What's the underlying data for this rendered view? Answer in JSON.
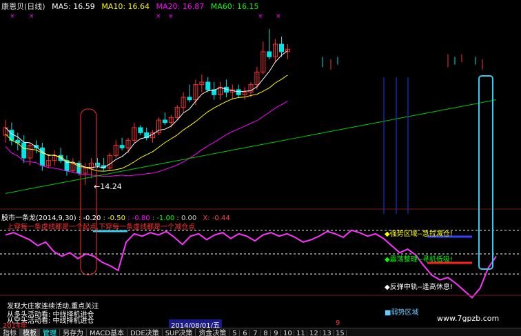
{
  "header": {
    "stock_name": "康恩贝(日线)",
    "ma": [
      {
        "label": "MA5: 16.59",
        "color": "#ffffff"
      },
      {
        "label": "MA10: 16.64",
        "color": "#ffff00"
      },
      {
        "label": "MA20: 16.87",
        "color": "#ff00ff"
      },
      {
        "label": "MA60: 16.15",
        "color": "#00ff00"
      }
    ]
  },
  "price_chart": {
    "low_label": "14.24",
    "candles": [
      {
        "o": 16.2,
        "h": 16.8,
        "l": 15.9,
        "c": 16.5
      },
      {
        "o": 16.4,
        "h": 16.7,
        "l": 15.8,
        "c": 16.0
      },
      {
        "o": 16.0,
        "h": 16.3,
        "l": 15.6,
        "c": 15.9
      },
      {
        "o": 15.9,
        "h": 16.2,
        "l": 15.1,
        "c": 15.3
      },
      {
        "o": 15.3,
        "h": 15.9,
        "l": 15.0,
        "c": 15.8
      },
      {
        "o": 15.8,
        "h": 16.0,
        "l": 15.5,
        "c": 15.7
      },
      {
        "o": 15.7,
        "h": 15.9,
        "l": 14.8,
        "c": 15.0
      },
      {
        "o": 15.0,
        "h": 15.4,
        "l": 14.9,
        "c": 15.2
      },
      {
        "o": 15.2,
        "h": 15.6,
        "l": 15.0,
        "c": 15.4
      },
      {
        "o": 15.4,
        "h": 15.7,
        "l": 15.1,
        "c": 15.2
      },
      {
        "o": 15.2,
        "h": 15.4,
        "l": 14.6,
        "c": 14.8
      },
      {
        "o": 14.8,
        "h": 15.3,
        "l": 14.7,
        "c": 15.1
      },
      {
        "o": 15.1,
        "h": 15.2,
        "l": 14.6,
        "c": 14.7
      },
      {
        "o": 14.7,
        "h": 15.1,
        "l": 14.24,
        "c": 14.9
      },
      {
        "o": 14.9,
        "h": 15.3,
        "l": 14.5,
        "c": 15.1
      },
      {
        "o": 15.1,
        "h": 15.3,
        "l": 14.9,
        "c": 15.0
      },
      {
        "o": 15.0,
        "h": 15.3,
        "l": 14.8,
        "c": 14.9
      },
      {
        "o": 14.9,
        "h": 15.5,
        "l": 14.8,
        "c": 15.4
      },
      {
        "o": 15.4,
        "h": 16.0,
        "l": 15.3,
        "c": 15.8
      },
      {
        "o": 15.8,
        "h": 16.1,
        "l": 15.6,
        "c": 15.7
      },
      {
        "o": 15.7,
        "h": 16.1,
        "l": 15.5,
        "c": 16.0
      },
      {
        "o": 16.0,
        "h": 16.7,
        "l": 15.9,
        "c": 16.5
      },
      {
        "o": 16.5,
        "h": 16.6,
        "l": 16.2,
        "c": 16.3
      },
      {
        "o": 16.3,
        "h": 16.5,
        "l": 16.0,
        "c": 16.1
      },
      {
        "o": 16.1,
        "h": 16.4,
        "l": 15.9,
        "c": 16.3
      },
      {
        "o": 16.3,
        "h": 16.9,
        "l": 16.2,
        "c": 16.8
      },
      {
        "o": 16.8,
        "h": 17.1,
        "l": 16.6,
        "c": 16.7
      },
      {
        "o": 16.7,
        "h": 17.0,
        "l": 16.5,
        "c": 16.9
      },
      {
        "o": 16.9,
        "h": 17.4,
        "l": 16.8,
        "c": 17.3
      },
      {
        "o": 17.3,
        "h": 17.9,
        "l": 17.1,
        "c": 17.7
      },
      {
        "o": 17.7,
        "h": 18.2,
        "l": 17.5,
        "c": 17.6
      },
      {
        "o": 17.6,
        "h": 18.4,
        "l": 17.4,
        "c": 18.2
      },
      {
        "o": 18.2,
        "h": 18.6,
        "l": 17.9,
        "c": 18.3
      },
      {
        "o": 18.3,
        "h": 18.5,
        "l": 17.9,
        "c": 18.0
      },
      {
        "o": 18.0,
        "h": 18.3,
        "l": 17.6,
        "c": 17.8
      },
      {
        "o": 17.8,
        "h": 18.3,
        "l": 17.6,
        "c": 18.1
      },
      {
        "o": 18.1,
        "h": 18.4,
        "l": 17.7,
        "c": 17.9
      },
      {
        "o": 17.9,
        "h": 18.2,
        "l": 17.6,
        "c": 18.0
      },
      {
        "o": 18.0,
        "h": 18.2,
        "l": 17.7,
        "c": 17.8
      },
      {
        "o": 17.8,
        "h": 18.1,
        "l": 17.6,
        "c": 17.9
      },
      {
        "o": 17.9,
        "h": 18.3,
        "l": 17.7,
        "c": 18.2
      },
      {
        "o": 18.2,
        "h": 18.9,
        "l": 18.0,
        "c": 18.7
      },
      {
        "o": 18.7,
        "h": 19.9,
        "l": 18.6,
        "c": 19.5
      },
      {
        "o": 19.5,
        "h": 20.4,
        "l": 19.2,
        "c": 19.3
      },
      {
        "o": 19.3,
        "h": 20.0,
        "l": 19.1,
        "c": 19.8
      },
      {
        "o": 19.8,
        "h": 20.1,
        "l": 19.3,
        "c": 19.5
      },
      {
        "o": 19.5,
        "h": 19.8,
        "l": 19.2,
        "c": 19.6
      }
    ]
  },
  "indicator": {
    "title": "股市一条龙(2014,9,30)",
    "values": [
      "-0.20",
      "-0.50",
      "-0.80",
      "-1.00",
      "0.00",
      "X: -0.44"
    ],
    "value_colors": [
      "#ffffff",
      "#ffff00",
      "#ff00ff",
      "#00ff00",
      "#cccccc",
      "#ff4040"
    ],
    "signal_text": "上穿每一条虚线都是一个起点,下穿每一条虚线都是一个减仓点",
    "label_strong": "强势区域--急拉减仓!",
    "label_consolidation": "震荡整理--寻机低吸!",
    "label_rebound": "反弹中轨--逢高休息!",
    "label_weak": "弱势区域",
    "line": [
      -0.32,
      -0.3,
      -0.33,
      -0.36,
      -0.41,
      -0.38,
      -0.46,
      -0.5,
      -0.47,
      -0.52,
      -0.48,
      -0.5,
      -0.55,
      -0.58,
      -0.62,
      -0.38,
      -0.31,
      -0.33,
      -0.3,
      -0.32,
      -0.29,
      -0.34,
      -0.4,
      -0.33,
      -0.31,
      -0.36,
      -0.32,
      -0.3,
      -0.35,
      -0.31,
      -0.33,
      -0.37,
      -0.32,
      -0.3,
      -0.33,
      -0.31,
      -0.34,
      -0.38,
      -0.36,
      -0.33,
      -0.29,
      -0.31,
      -0.34,
      -0.28,
      -0.3,
      -0.33,
      -0.31,
      -0.35,
      -0.41,
      -0.47,
      -0.44,
      -0.49,
      -0.58,
      -0.66,
      -0.7,
      -0.68,
      -0.73,
      -0.79,
      -0.85,
      -0.77,
      -0.6,
      -0.5
    ]
  },
  "bottom_info": {
    "line1": "发现大庄家连续活动,重点关注",
    "line2": "从多头活动看: 中线择机进仓",
    "line3": "从空头活动看: 中线择机进仓"
  },
  "status": {
    "year": "2014年",
    "date": "2014/08/01/五",
    "month_marker": "9",
    "watermark": "www.7gpzb.com"
  },
  "tabs": [
    "指标",
    "模板",
    "管理",
    "另存为",
    "MACD基本",
    "DDE决策",
    "SUP决策",
    "资金决策"
  ],
  "page_numbers": [
    "5",
    "6",
    "7",
    "8",
    "9",
    "10",
    "11",
    "12",
    "13",
    "15"
  ],
  "colors": {
    "up": "#ff3030",
    "down": "#00e5e5",
    "ma5": "#ffffff",
    "ma10": "#ffff00",
    "ma20": "#ff00ff",
    "ma60": "#00cc00",
    "indicator_line": "#ff33ff",
    "highlight": "#ff3030",
    "cyan_box": "#33ccee"
  }
}
